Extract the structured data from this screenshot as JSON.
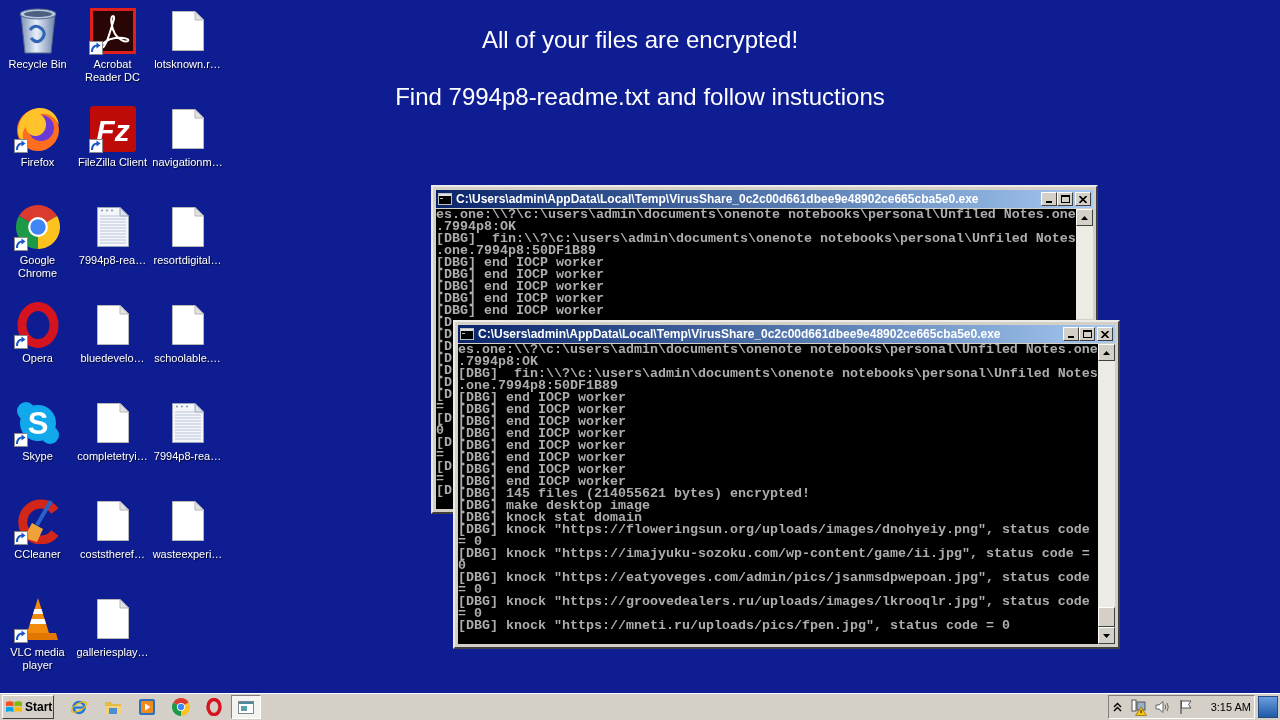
{
  "desktop": {
    "message": {
      "heading": "All of your files are encrypted!",
      "text": "Find 7994p8-readme.txt and follow instuctions"
    },
    "icons": [
      {
        "label": "Recycle Bin",
        "kind": "recycle-bin",
        "shortcut": false
      },
      {
        "label": "Firefox",
        "kind": "firefox",
        "shortcut": true
      },
      {
        "label": "Google Chrome",
        "kind": "chrome",
        "shortcut": true
      },
      {
        "label": "Opera",
        "kind": "opera",
        "shortcut": true
      },
      {
        "label": "Skype",
        "kind": "skype",
        "shortcut": true,
        "logo_text": "S"
      },
      {
        "label": "CCleaner",
        "kind": "ccleaner",
        "shortcut": true
      },
      {
        "label": "VLC media player",
        "kind": "vlc",
        "shortcut": true
      },
      {
        "label": "Acrobat Reader DC",
        "kind": "acrobat",
        "shortcut": true
      },
      {
        "label": "FileZilla Client",
        "kind": "filezilla",
        "shortcut": true,
        "logo_text": "Fz"
      },
      {
        "label": "7994p8-rea…",
        "kind": "text-document",
        "shortcut": false
      },
      {
        "label": "bluedevelo…",
        "kind": "document",
        "shortcut": false
      },
      {
        "label": "completetryi…",
        "kind": "document",
        "shortcut": false
      },
      {
        "label": "coststheref…",
        "kind": "document",
        "shortcut": false
      },
      {
        "label": "galleriesplay…",
        "kind": "document",
        "shortcut": false
      },
      {
        "label": "lotsknown.r…",
        "kind": "document",
        "shortcut": false
      },
      {
        "label": "navigationm…",
        "kind": "document",
        "shortcut": false
      },
      {
        "label": "resortdigital…",
        "kind": "document",
        "shortcut": false
      },
      {
        "label": "schoolable.…",
        "kind": "document",
        "shortcut": false
      },
      {
        "label": "7994p8-rea…",
        "kind": "text-document",
        "shortcut": false
      },
      {
        "label": "wasteexperi…",
        "kind": "document",
        "shortcut": false
      }
    ]
  },
  "windows": [
    {
      "title": "C:\\Users\\admin\\AppData\\Local\\Temp\\VirusShare_0c2c00d661dbee9e48902ce665cba5e0.exe",
      "lines": [
        "es.one:\\\\?\\c:\\users\\admin\\documents\\onenote notebooks\\personal\\Unfiled Notes.one",
        ".7994p8:OK",
        "[DBG]  fin:\\\\?\\c:\\users\\admin\\documents\\onenote notebooks\\personal\\Unfiled Notes",
        ".one.7994p8:50DF1B89",
        "[DBG] end IOCP worker",
        "[DBG] end IOCP worker",
        "[DBG] end IOCP worker",
        "[DBG] end IOCP worker",
        "[DBG] end IOCP worker",
        "[D",
        "[D",
        "[D",
        "[D",
        "[D",
        "[D",
        "[D",
        "=",
        "[D",
        "0",
        "[D",
        "=",
        "[D",
        "=",
        "[D"
      ]
    },
    {
      "title": "C:\\Users\\admin\\AppData\\Local\\Temp\\VirusShare_0c2c00d661dbee9e48902ce665cba5e0.exe",
      "lines": [
        "es.one:\\\\?\\c:\\users\\admin\\documents\\onenote notebooks\\personal\\Unfiled Notes.one",
        ".7994p8:OK",
        "[DBG]  fin:\\\\?\\c:\\users\\admin\\documents\\onenote notebooks\\personal\\Unfiled Notes",
        ".one.7994p8:50DF1B89",
        "[DBG] end IOCP worker",
        "[DBG] end IOCP worker",
        "[DBG] end IOCP worker",
        "[DBG] end IOCP worker",
        "[DBG] end IOCP worker",
        "[DBG] end IOCP worker",
        "[DBG] end IOCP worker",
        "[DBG] end IOCP worker",
        "[DBG] 145 files (214055621 bytes) encrypted!",
        "[DBG] make desktop image",
        "[DBG] knock stat domain",
        "[DBG] knock \"https://floweringsun.org/uploads/images/dnohyeiy.png\", status code",
        "= 0",
        "[DBG] knock \"https://imajyuku-sozoku.com/wp-content/game/ii.jpg\", status code =",
        "0",
        "[DBG] knock \"https://eatyoveges.com/admin/pics/jsanmsdpwepoan.jpg\", status code",
        "= 0",
        "[DBG] knock \"https://groovedealers.ru/uploads/images/lkrooqlr.jpg\", status code",
        "= 0",
        "[DBG] knock \"https://mneti.ru/uploads/pics/fpen.jpg\", status code = 0"
      ]
    }
  ],
  "taskbar": {
    "start_button": "Start",
    "task_buttons": [
      {
        "selected": true
      }
    ],
    "clock": "3:15 AM"
  }
}
